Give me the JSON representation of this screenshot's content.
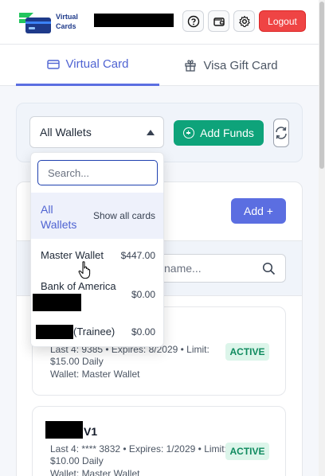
{
  "header": {
    "logo_line1": "Virtual",
    "logo_line2": "Cards",
    "logout_label": "Logout",
    "icons": [
      "help-circle-icon",
      "wallet-icon",
      "gear-icon"
    ]
  },
  "tabs": [
    {
      "label": "Virtual Card",
      "icon": "credit-card-icon",
      "active": true
    },
    {
      "label": "Visa Gift Card",
      "icon": "gift-icon",
      "active": false
    }
  ],
  "filter": {
    "wallet_selected": "All Wallets",
    "add_funds_label": "Add Funds"
  },
  "cards_panel": {
    "add_label": "Add +",
    "search_placeholder": "name..."
  },
  "cards": [
    {
      "name_suffix": "",
      "last4_line": "Last 4:      9385 • Expires: 8/2029 • Limit:",
      "limit_line": "$15.00 Daily",
      "wallet_line": "Wallet: Master Wallet",
      "status": "ACTIVE"
    },
    {
      "name_suffix": "V1",
      "last4_line": "Last 4: **** 3832 • Expires: 1/2029 • Limit:",
      "limit_line": "$10.00 Daily",
      "wallet_line": "Wallet: Master Wallet",
      "status": "ACTIVE"
    }
  ],
  "dropdown": {
    "search_placeholder": "Search...",
    "all_line1": "All",
    "all_line2": "Wallets",
    "all_hint": "Show all cards",
    "wallets": [
      {
        "name": "Master Wallet",
        "amount": "$447.00"
      },
      {
        "name": "Bank of America",
        "amount": "$0.00"
      },
      {
        "name": "(Trainee)",
        "amount": "$0.00"
      }
    ]
  },
  "colors": {
    "accent": "#5b6ee1",
    "success": "#0ea37a",
    "danger": "#ef4444"
  }
}
